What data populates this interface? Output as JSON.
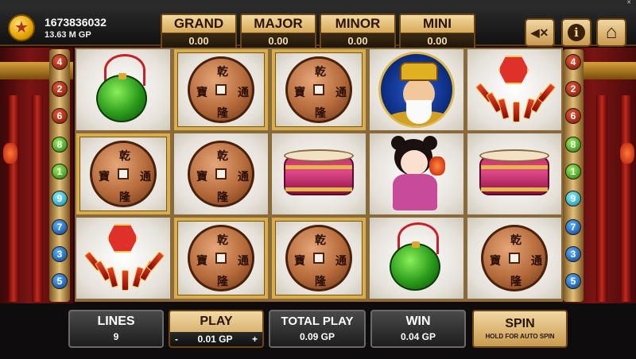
{
  "window": {
    "title": "",
    "close": "✕"
  },
  "account": {
    "id": "1673836032",
    "balance": "13.63 M GP",
    "icon": "star-coin-icon"
  },
  "jackpots": [
    {
      "name": "GRAND",
      "value": "0.00"
    },
    {
      "name": "MAJOR",
      "value": "0.00"
    },
    {
      "name": "MINOR",
      "value": "0.00"
    },
    {
      "name": "MINI",
      "value": "0.00"
    }
  ],
  "top_buttons": [
    {
      "icon": "mute-icon",
      "glyph": "◀✕"
    },
    {
      "icon": "info-icon",
      "glyph": "i"
    },
    {
      "icon": "home-icon",
      "glyph": "⌂"
    }
  ],
  "paylines": {
    "left": [
      "4",
      "2",
      "6",
      "8",
      "1",
      "9",
      "7",
      "3",
      "5"
    ],
    "right": [
      "4",
      "2",
      "6",
      "8",
      "1",
      "9",
      "7",
      "3",
      "5"
    ],
    "colors": [
      "red",
      "red",
      "red",
      "green",
      "green",
      "cyan",
      "blue",
      "blue",
      "blue"
    ]
  },
  "reels": [
    [
      "jade",
      "coin",
      "firecracker"
    ],
    [
      "coin",
      "coin",
      "coin"
    ],
    [
      "coin",
      "drum",
      "coin"
    ],
    [
      "god",
      "girl",
      "jade"
    ],
    [
      "firecracker",
      "drum",
      "coin"
    ]
  ],
  "gold_frames": [
    [
      0,
      1
    ],
    [
      1,
      0
    ],
    [
      1,
      2
    ],
    [
      2,
      0
    ],
    [
      2,
      2
    ]
  ],
  "coin_chars": [
    "乾",
    "通",
    "隆",
    "寶"
  ],
  "bottom": {
    "lines": {
      "label": "LINES",
      "value": "9"
    },
    "play": {
      "label": "PLAY",
      "minus": "-",
      "value": "0.01 GP",
      "plus": "+"
    },
    "total_play": {
      "label": "TOTAL PLAY",
      "value": "0.09 GP"
    },
    "win": {
      "label": "WIN",
      "value": "0.04 GP"
    },
    "spin": {
      "label": "SPIN",
      "sub": "HOLD FOR AUTO SPIN"
    }
  },
  "colors": {
    "gold": "#d9ad4a",
    "panel_dark": "#1e1e1e",
    "reel_bg": "#ffffff"
  }
}
